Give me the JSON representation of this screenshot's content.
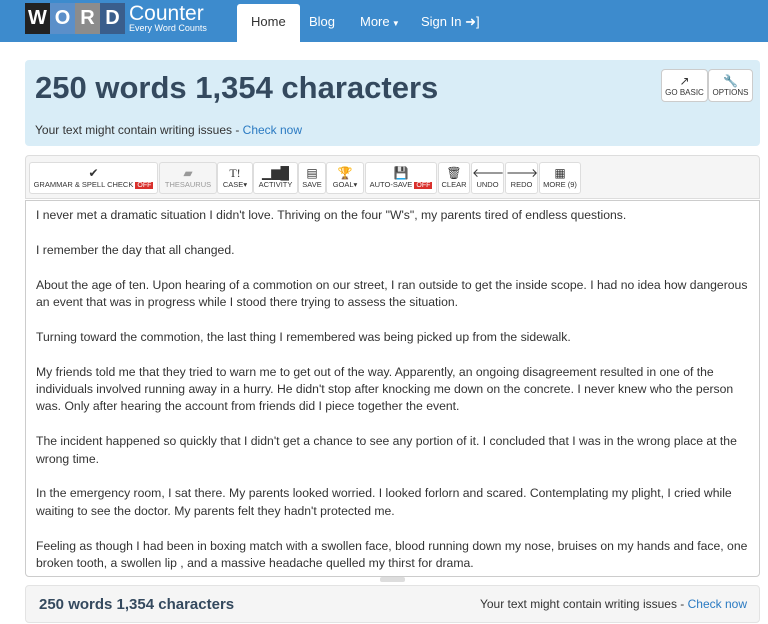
{
  "logo": {
    "letters": [
      "W",
      "O",
      "R",
      "D"
    ],
    "name": "Counter",
    "tagline": "Every Word Counts",
    "colors": [
      "#222222",
      "#5b8fc9",
      "#8c8c8c",
      "#3a5e8c"
    ]
  },
  "nav": {
    "items": [
      "Home",
      "Blog",
      "More",
      "Sign In"
    ]
  },
  "summary": {
    "title": "250 words 1,354 characters",
    "issue_text": "Your text might contain writing issues - ",
    "issue_link": "Check now",
    "go_basic": "GO BASIC",
    "options": "OPTIONS"
  },
  "toolbar": {
    "grammar": "GRAMMAR & SPELL CHECK",
    "grammar_state": "OFF",
    "thesaurus": "THESAURUS",
    "case": "CASE",
    "activity": "ACTIVITY",
    "save": "SAVE",
    "goal": "GOAL",
    "autosave": "AUTO-SAVE",
    "autosave_state": "OFF",
    "clear": "CLEAR",
    "undo": "UNDO",
    "redo": "REDO",
    "more": "MORE (9)"
  },
  "text": {
    "paragraphs": [
      "I never met a dramatic situation I didn't  love. Thriving on the four \"W's\", my parents tired of endless questions.",
      "I remember the day that all changed.",
      "About the age of ten. Upon hearing of a commotion on our street, I ran outside to get the inside scope. I had no idea how dangerous an event that was in progress while I stood there trying to assess the situation.",
      "Turning toward the commotion, the last thing I remembered was being picked up from the sidewalk.",
      "My friends told me that they tried to warn me to get out of the way. Apparently, an ongoing disagreement resulted in one of the individuals involved running away in a hurry. He didn't stop after knocking me down on the concrete. I never knew who the person was. Only after hearing the account from friends did I piece together the event.",
      "The incident happened so quickly that I didn't get a chance to see any portion of it. I concluded that I was in the wrong place at the wrong time.",
      "In the emergency room, I sat there. My parents looked worried. I looked forlorn and scared. Contemplating my plight, I cried while waiting to see the doctor. My parents felt they hadn't protected me.",
      "Feeling as though I had been in boxing match with a swollen face, blood running down my nose, bruises on my hands and face, one broken tooth, a swollen lip , and a massive headache quelled my thirst for drama."
    ]
  },
  "footer": {
    "count": "250 words 1,354 characters",
    "issue_text": "Your text might contain writing issues - ",
    "issue_link": "Check now"
  }
}
